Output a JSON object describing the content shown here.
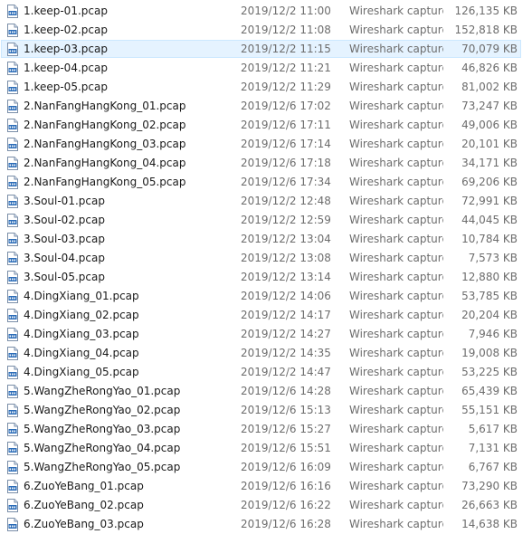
{
  "files": [
    {
      "name": "1.keep-01.pcap",
      "date": "2019/12/2 11:00",
      "type": "Wireshark capture file",
      "size": "126,135 KB",
      "icon": "pcap-file-icon",
      "selected": false
    },
    {
      "name": "1.keep-02.pcap",
      "date": "2019/12/2 11:08",
      "type": "Wireshark capture file",
      "size": "152,818 KB",
      "icon": "pcap-file-icon",
      "selected": false
    },
    {
      "name": "1.keep-03.pcap",
      "date": "2019/12/2 11:15",
      "type": "Wireshark capture file",
      "size": "70,079 KB",
      "icon": "pcap-file-icon",
      "selected": true
    },
    {
      "name": "1.keep-04.pcap",
      "date": "2019/12/2 11:21",
      "type": "Wireshark capture file",
      "size": "46,826 KB",
      "icon": "pcap-file-icon",
      "selected": false
    },
    {
      "name": "1.keep-05.pcap",
      "date": "2019/12/2 11:29",
      "type": "Wireshark capture file",
      "size": "81,002 KB",
      "icon": "pcap-file-icon",
      "selected": false
    },
    {
      "name": "2.NanFangHangKong_01.pcap",
      "date": "2019/12/6 17:02",
      "type": "Wireshark capture file",
      "size": "73,247 KB",
      "icon": "pcap-file-icon",
      "selected": false
    },
    {
      "name": "2.NanFangHangKong_02.pcap",
      "date": "2019/12/6 17:11",
      "type": "Wireshark capture file",
      "size": "49,006 KB",
      "icon": "pcap-file-icon",
      "selected": false
    },
    {
      "name": "2.NanFangHangKong_03.pcap",
      "date": "2019/12/6 17:14",
      "type": "Wireshark capture file",
      "size": "20,101 KB",
      "icon": "pcap-file-icon",
      "selected": false
    },
    {
      "name": "2.NanFangHangKong_04.pcap",
      "date": "2019/12/6 17:18",
      "type": "Wireshark capture file",
      "size": "34,171 KB",
      "icon": "pcap-file-icon",
      "selected": false
    },
    {
      "name": "2.NanFangHangKong_05.pcap",
      "date": "2019/12/6 17:34",
      "type": "Wireshark capture file",
      "size": "69,206 KB",
      "icon": "pcap-file-icon",
      "selected": false
    },
    {
      "name": "3.Soul-01.pcap",
      "date": "2019/12/2 12:48",
      "type": "Wireshark capture file",
      "size": "72,991 KB",
      "icon": "pcap-file-icon",
      "selected": false
    },
    {
      "name": "3.Soul-02.pcap",
      "date": "2019/12/2 12:59",
      "type": "Wireshark capture file",
      "size": "44,045 KB",
      "icon": "pcap-file-icon",
      "selected": false
    },
    {
      "name": "3.Soul-03.pcap",
      "date": "2019/12/2 13:04",
      "type": "Wireshark capture file",
      "size": "10,784 KB",
      "icon": "pcap-file-icon",
      "selected": false
    },
    {
      "name": "3.Soul-04.pcap",
      "date": "2019/12/2 13:08",
      "type": "Wireshark capture file",
      "size": "7,573 KB",
      "icon": "pcap-file-icon",
      "selected": false
    },
    {
      "name": "3.Soul-05.pcap",
      "date": "2019/12/2 13:14",
      "type": "Wireshark capture file",
      "size": "12,880 KB",
      "icon": "pcap-file-icon",
      "selected": false
    },
    {
      "name": "4.DingXiang_01.pcap",
      "date": "2019/12/2 14:06",
      "type": "Wireshark capture file",
      "size": "53,785 KB",
      "icon": "pcap-file-icon",
      "selected": false
    },
    {
      "name": "4.DingXiang_02.pcap",
      "date": "2019/12/2 14:17",
      "type": "Wireshark capture file",
      "size": "20,204 KB",
      "icon": "pcap-file-icon",
      "selected": false
    },
    {
      "name": "4.DingXiang_03.pcap",
      "date": "2019/12/2 14:27",
      "type": "Wireshark capture file",
      "size": "7,946 KB",
      "icon": "pcap-file-icon",
      "selected": false
    },
    {
      "name": "4.DingXiang_04.pcap",
      "date": "2019/12/2 14:35",
      "type": "Wireshark capture file",
      "size": "19,008 KB",
      "icon": "pcap-file-icon",
      "selected": false
    },
    {
      "name": "4.DingXiang_05.pcap",
      "date": "2019/12/2 14:47",
      "type": "Wireshark capture file",
      "size": "53,225 KB",
      "icon": "pcap-file-icon",
      "selected": false
    },
    {
      "name": "5.WangZheRongYao_01.pcap",
      "date": "2019/12/6 14:28",
      "type": "Wireshark capture file",
      "size": "65,439 KB",
      "icon": "pcap-file-icon",
      "selected": false
    },
    {
      "name": "5.WangZheRongYao_02.pcap",
      "date": "2019/12/6 15:13",
      "type": "Wireshark capture file",
      "size": "55,151 KB",
      "icon": "pcap-file-icon",
      "selected": false
    },
    {
      "name": "5.WangZheRongYao_03.pcap",
      "date": "2019/12/6 15:27",
      "type": "Wireshark capture file",
      "size": "5,617 KB",
      "icon": "pcap-file-icon",
      "selected": false
    },
    {
      "name": "5.WangZheRongYao_04.pcap",
      "date": "2019/12/6 15:51",
      "type": "Wireshark capture file",
      "size": "7,131 KB",
      "icon": "pcap-file-icon",
      "selected": false
    },
    {
      "name": "5.WangZheRongYao_05.pcap",
      "date": "2019/12/6 16:09",
      "type": "Wireshark capture file",
      "size": "6,767 KB",
      "icon": "pcap-file-icon",
      "selected": false
    },
    {
      "name": "6.ZuoYeBang_01.pcap",
      "date": "2019/12/6 16:16",
      "type": "Wireshark capture file",
      "size": "73,290 KB",
      "icon": "pcap-file-icon",
      "selected": false
    },
    {
      "name": "6.ZuoYeBang_02.pcap",
      "date": "2019/12/6 16:22",
      "type": "Wireshark capture file",
      "size": "26,663 KB",
      "icon": "pcap-file-icon",
      "selected": false
    },
    {
      "name": "6.ZuoYeBang_03.pcap",
      "date": "2019/12/6 16:28",
      "type": "Wireshark capture file",
      "size": "14,638 KB",
      "icon": "pcap-file-icon",
      "selected": false
    }
  ],
  "colors": {
    "selected_bg": "#e5f3ff",
    "selected_border": "#cce8ff",
    "icon_blue": "#2b6cb8",
    "secondary_text": "#6d6d6d"
  }
}
